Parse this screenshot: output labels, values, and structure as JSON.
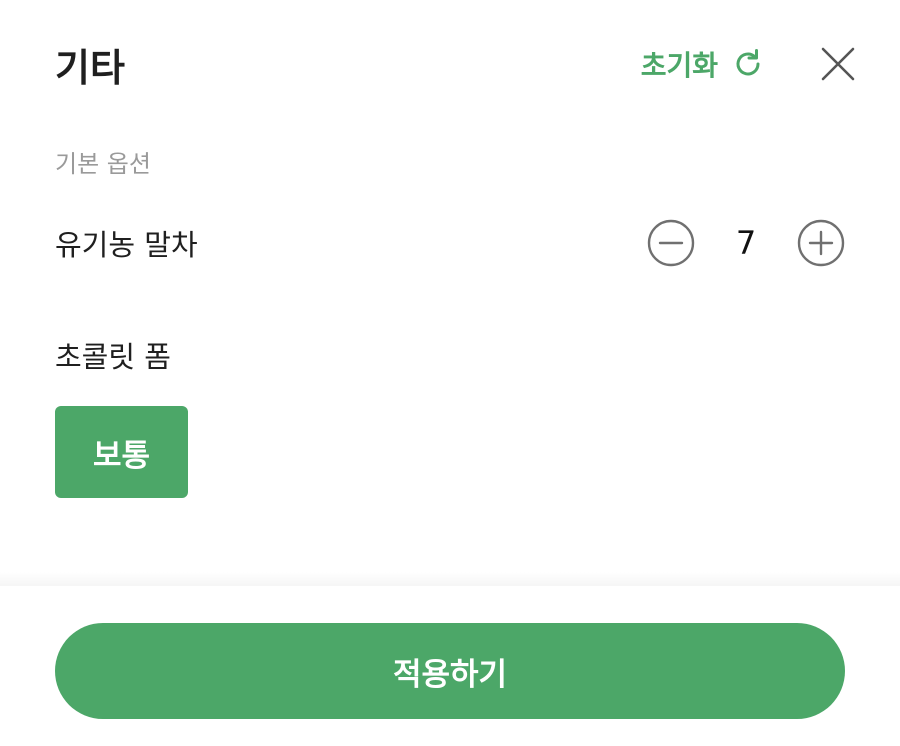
{
  "header": {
    "title": "기타",
    "reset_label": "초기화",
    "reset_icon": "refresh-icon",
    "close_icon": "close-icon"
  },
  "section": {
    "label": "기본 옵션"
  },
  "option": {
    "name": "유기농 말차",
    "quantity": "7",
    "minus_icon": "minus-circle-icon",
    "plus_icon": "plus-circle-icon"
  },
  "group": {
    "title": "초콜릿 폼",
    "selected_option": "보통"
  },
  "footer": {
    "apply_label": "적용하기"
  },
  "colors": {
    "accent": "#4ca768",
    "text": "#1f1f1f",
    "muted": "#9a9a9a",
    "icon": "#707070"
  }
}
